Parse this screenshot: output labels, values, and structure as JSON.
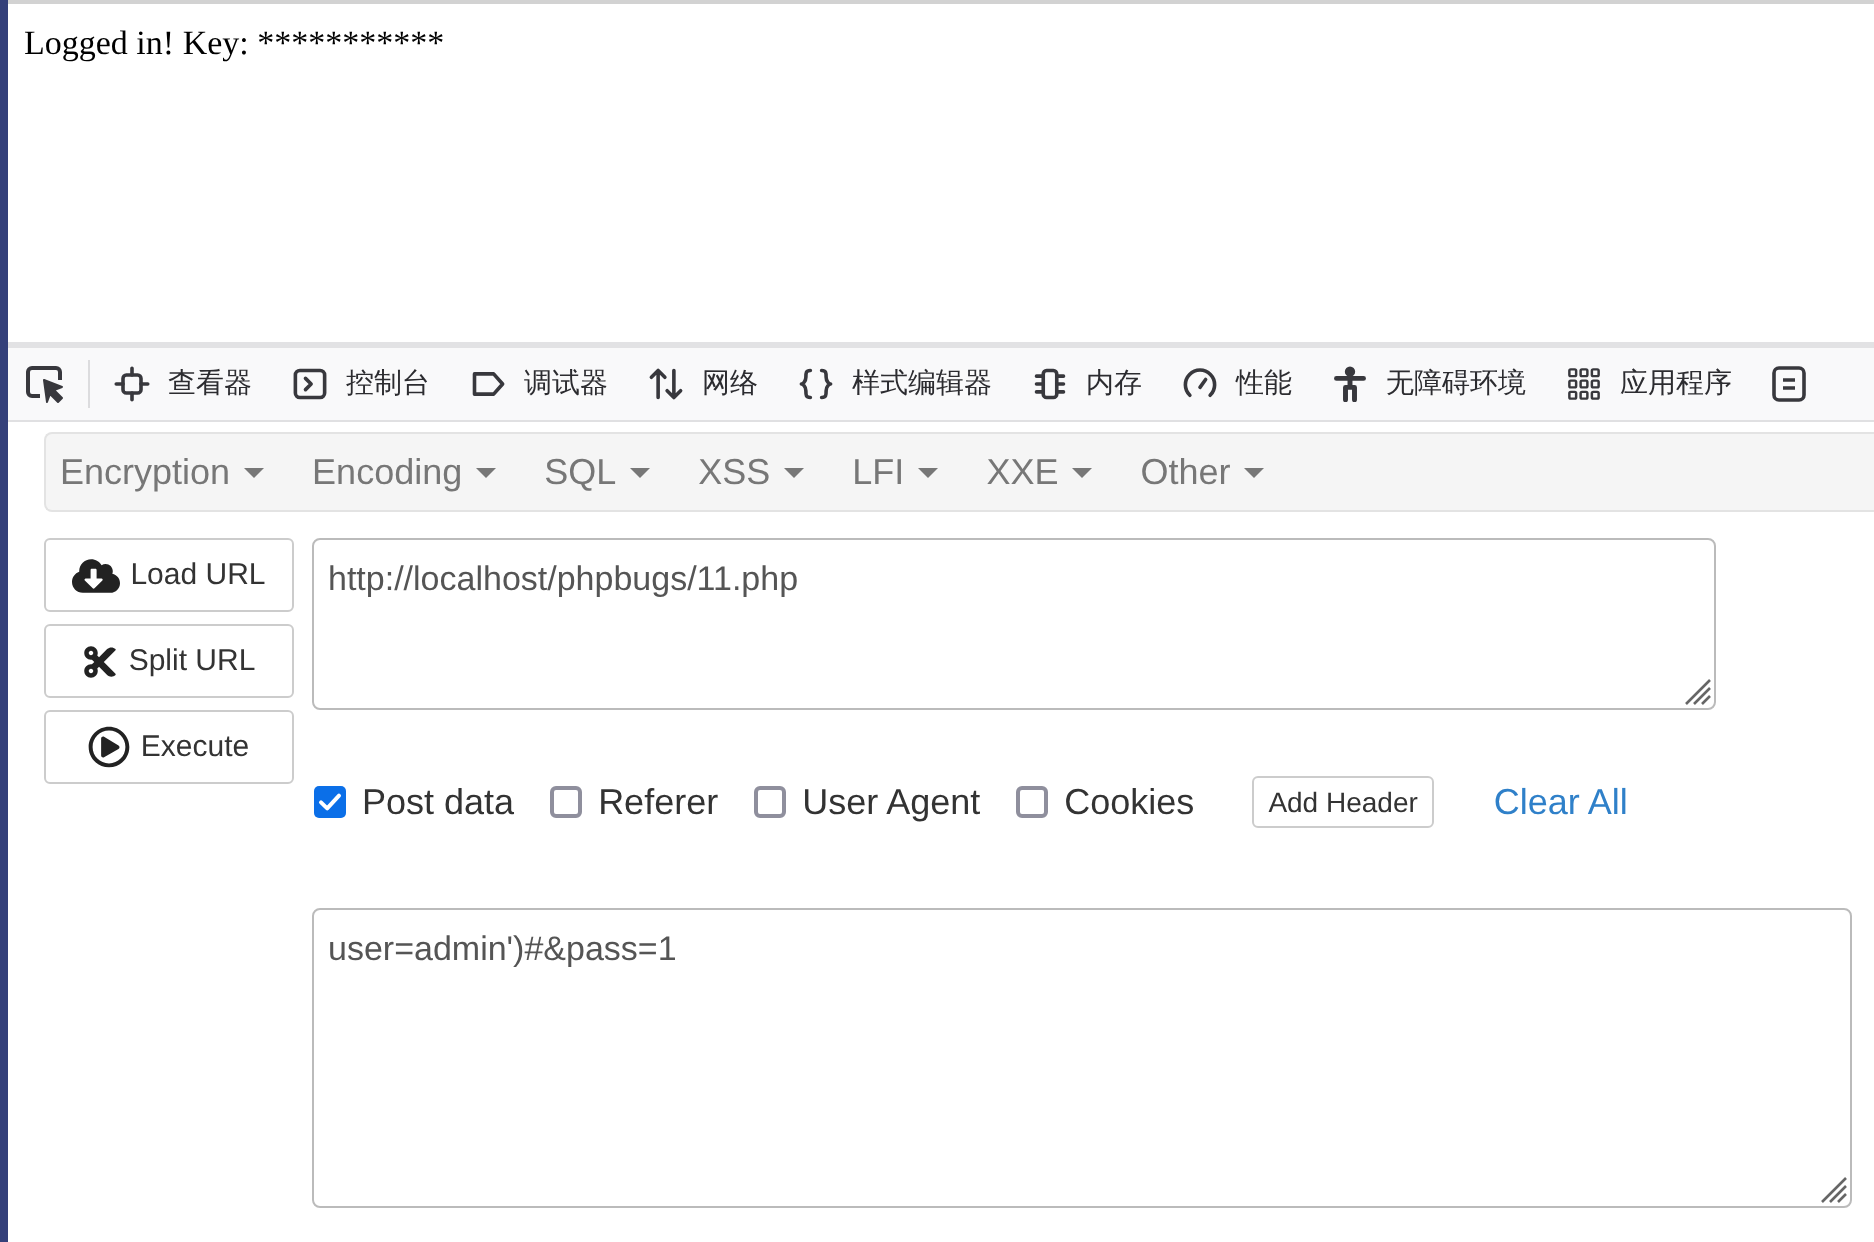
{
  "page": {
    "message": "Logged in! Key: ***********"
  },
  "devtools": {
    "tabs": [
      {
        "label": "查看器",
        "selected": false
      },
      {
        "label": "控制台",
        "selected": false
      },
      {
        "label": "调试器",
        "selected": false
      },
      {
        "label": "网络",
        "selected": false
      },
      {
        "label": "样式编辑器",
        "selected": false
      },
      {
        "label": "内存",
        "selected": false
      },
      {
        "label": "性能",
        "selected": false
      },
      {
        "label": "无障碍环境",
        "selected": false
      },
      {
        "label": "应用程序",
        "selected": false
      }
    ]
  },
  "hackbar": {
    "menu": [
      {
        "label": "Encryption"
      },
      {
        "label": "Encoding"
      },
      {
        "label": "SQL"
      },
      {
        "label": "XSS"
      },
      {
        "label": "LFI"
      },
      {
        "label": "XXE"
      },
      {
        "label": "Other"
      }
    ],
    "buttons": [
      {
        "label": "Load URL"
      },
      {
        "label": "Split URL"
      },
      {
        "label": "Execute"
      }
    ],
    "url_field": {
      "value": "http://localhost/phpbugs/11.php"
    },
    "options": [
      {
        "label": "Post data",
        "checked": true
      },
      {
        "label": "Referer",
        "checked": false
      },
      {
        "label": "User Agent",
        "checked": false
      },
      {
        "label": "Cookies",
        "checked": false
      }
    ],
    "add_header_button": "Add Header",
    "clear_all_link": "Clear All",
    "post_data_field": {
      "value": "user=admin')#&pass=1"
    }
  }
}
